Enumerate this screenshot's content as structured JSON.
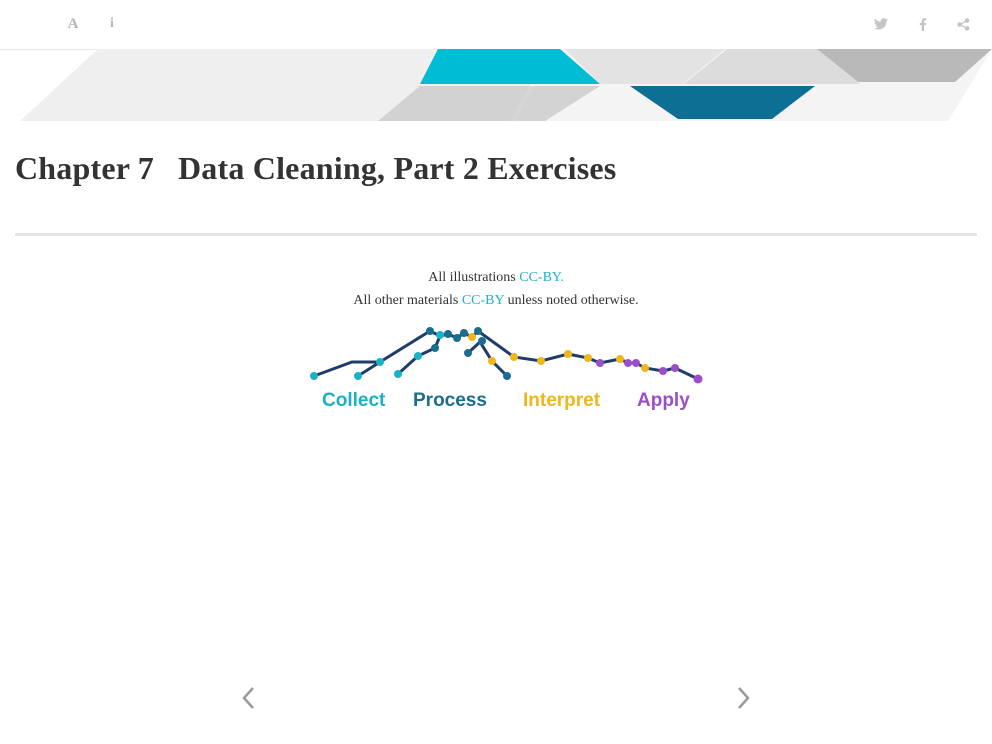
{
  "toolbar": {
    "left_buttons": [
      {
        "name": "font-settings",
        "icon": "font-icon",
        "glyph": "A"
      },
      {
        "name": "info",
        "icon": "info-icon",
        "glyph": "i"
      }
    ],
    "right_buttons": [
      {
        "name": "twitter",
        "icon": "twitter-icon"
      },
      {
        "name": "facebook",
        "icon": "facebook-icon"
      },
      {
        "name": "share",
        "icon": "share-icon"
      }
    ]
  },
  "chapter": {
    "number": "Chapter 7",
    "title": "Data Cleaning, Part 2 Exercises"
  },
  "license": {
    "line1_prefix": "All illustrations ",
    "line1_link": "CC-BY.",
    "line2_prefix": "All other materials ",
    "line2_link": "CC-BY",
    "line2_suffix": " unless noted otherwise."
  },
  "logo": {
    "labels": [
      "Collect",
      "Process",
      "Interpret",
      "Apply"
    ],
    "colors": {
      "collect": "#1ab2c6",
      "process": "#1a6e8e",
      "interpret": "#f0b71a",
      "apply": "#9a4fc8",
      "line": "#1e3e6a"
    }
  },
  "navigation": {
    "previous_icon": "chevron-left-icon",
    "next_icon": "chevron-right-icon"
  },
  "colors": {
    "link": "#1ab2c6",
    "banner_teal": "#00bcd4",
    "banner_dark_teal": "#0e6f94",
    "banner_grey": "#c7c7c7",
    "banner_light_grey": "#ececec"
  }
}
